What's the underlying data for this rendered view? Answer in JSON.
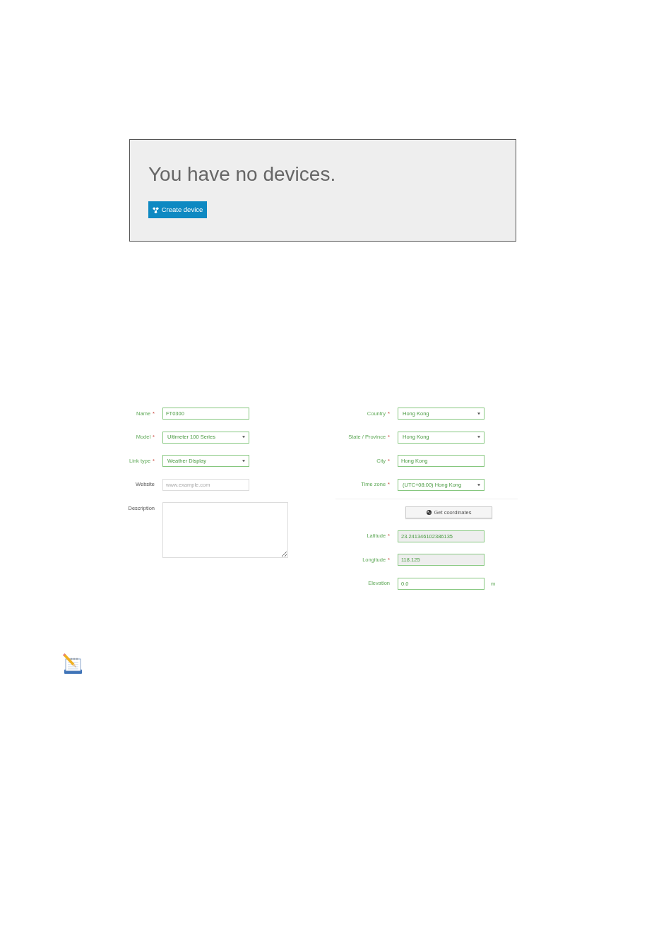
{
  "empty_state": {
    "heading": "You have no devices.",
    "button": {
      "label": "Create device"
    }
  },
  "device_form": {
    "left_fields": [
      {
        "kind": "text",
        "label": "Name",
        "required_mark": "*",
        "valid": true,
        "value": "FT0300"
      },
      {
        "kind": "select",
        "label": "Model",
        "required_mark": "*",
        "valid": true,
        "value": "Ultimeter 100 Series"
      },
      {
        "kind": "select",
        "label": "Link type",
        "required_mark": "*",
        "valid": true,
        "value": "Weather Display"
      },
      {
        "kind": "text",
        "label": "Website",
        "valid": false,
        "placeholder": "www.example.com"
      },
      {
        "kind": "textarea",
        "label": "Description",
        "valid": false
      }
    ],
    "location_fields": [
      {
        "kind": "select",
        "label": "Country",
        "required_mark": "*",
        "valid": true,
        "value": "Hong Kong"
      },
      {
        "kind": "select",
        "label": "State / Province",
        "required_mark": "*",
        "valid": true,
        "value": "Hong Kong"
      },
      {
        "kind": "text",
        "label": "City",
        "required_mark": "*",
        "valid": true,
        "value": "Hong Kong"
      },
      {
        "kind": "select",
        "label": "Time zone",
        "required_mark": "*",
        "valid": true,
        "value": "(UTC+08:00) Hong Kong"
      }
    ],
    "coordinates": {
      "button": {
        "label": "Get coordinates"
      },
      "fields": [
        {
          "kind": "text",
          "label": "Latitude",
          "required_mark": "*",
          "valid": true,
          "readonly": true,
          "value": "23.241346102386135"
        },
        {
          "kind": "text",
          "label": "Longitude",
          "required_mark": "*",
          "valid": true,
          "readonly": true,
          "value": "118.125"
        },
        {
          "kind": "text",
          "label": "Elevation",
          "valid": true,
          "readonly": false,
          "value": "0.0",
          "unit": "m"
        }
      ]
    }
  }
}
